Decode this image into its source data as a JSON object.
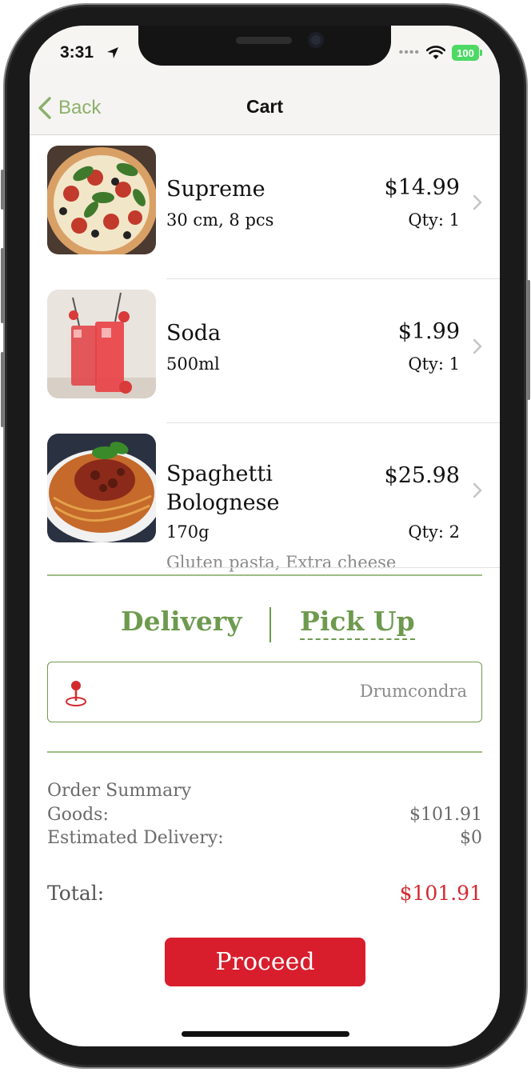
{
  "status_bar": {
    "time": "3:31",
    "battery": "100"
  },
  "nav": {
    "back_label": "Back",
    "title": "Cart"
  },
  "cart_items": [
    {
      "name": "Supreme",
      "price": "$14.99",
      "detail": "30 cm, 8 pcs",
      "qty": "Qty: 1",
      "extras": ""
    },
    {
      "name": "Soda",
      "price": "$1.99",
      "detail": "500ml",
      "qty": "Qty: 1",
      "extras": ""
    },
    {
      "name": "Spaghetti\nBolognese",
      "price": "$25.98",
      "detail": "170g",
      "qty": "Qty: 2",
      "extras": "Gluten pasta, Extra cheese"
    }
  ],
  "fulfillment": {
    "delivery_label": "Delivery",
    "pickup_label": "Pick Up"
  },
  "address": {
    "value": "Drumcondra"
  },
  "summary": {
    "title": "Order Summary",
    "goods_label": "Goods:",
    "goods_value": "$101.91",
    "delivery_label": "Estimated Delivery:",
    "delivery_value": "$0",
    "total_label": "Total:",
    "total_value": "$101.91"
  },
  "actions": {
    "proceed_label": "Proceed"
  },
  "colors": {
    "accent_green": "#6e9a4f",
    "accent_red": "#d81e2d",
    "back_green": "#8cb06c"
  }
}
